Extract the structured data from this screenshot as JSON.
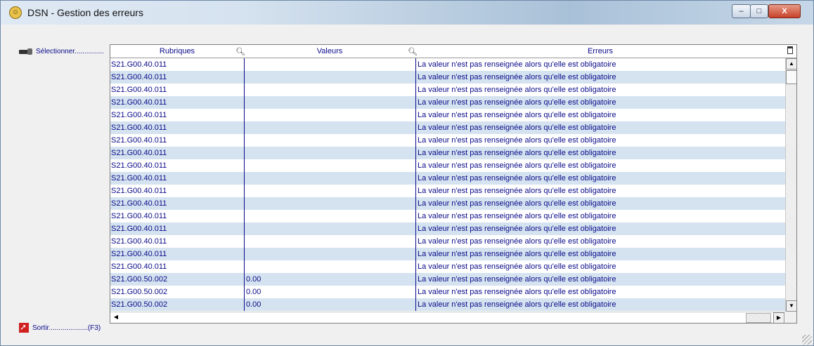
{
  "window": {
    "title": "DSN - Gestion des erreurs",
    "controls": {
      "minimize": "–",
      "maximize": "□",
      "close": "X"
    }
  },
  "sidebar": {
    "select_label": "Sélectionner...............",
    "exit_label": "Sortir....................(F3)"
  },
  "grid": {
    "columns": [
      "Rubriques",
      "Valeurs",
      "Erreurs"
    ],
    "rows": [
      {
        "rubrique": "S21.G00.40.011",
        "valeur": "",
        "erreur": "La valeur n'est pas renseignée alors qu'elle est obligatoire"
      },
      {
        "rubrique": "S21.G00.40.011",
        "valeur": "",
        "erreur": "La valeur n'est pas renseignée alors qu'elle est obligatoire"
      },
      {
        "rubrique": "S21.G00.40.011",
        "valeur": "",
        "erreur": "La valeur n'est pas renseignée alors qu'elle est obligatoire"
      },
      {
        "rubrique": "S21.G00.40.011",
        "valeur": "",
        "erreur": "La valeur n'est pas renseignée alors qu'elle est obligatoire"
      },
      {
        "rubrique": "S21.G00.40.011",
        "valeur": "",
        "erreur": "La valeur n'est pas renseignée alors qu'elle est obligatoire"
      },
      {
        "rubrique": "S21.G00.40.011",
        "valeur": "",
        "erreur": "La valeur n'est pas renseignée alors qu'elle est obligatoire"
      },
      {
        "rubrique": "S21.G00.40.011",
        "valeur": "",
        "erreur": "La valeur n'est pas renseignée alors qu'elle est obligatoire"
      },
      {
        "rubrique": "S21.G00.40.011",
        "valeur": "",
        "erreur": "La valeur n'est pas renseignée alors qu'elle est obligatoire"
      },
      {
        "rubrique": "S21.G00.40.011",
        "valeur": "",
        "erreur": "La valeur n'est pas renseignée alors qu'elle est obligatoire"
      },
      {
        "rubrique": "S21.G00.40.011",
        "valeur": "",
        "erreur": "La valeur n'est pas renseignée alors qu'elle est obligatoire"
      },
      {
        "rubrique": "S21.G00.40.011",
        "valeur": "",
        "erreur": "La valeur n'est pas renseignée alors qu'elle est obligatoire"
      },
      {
        "rubrique": "S21.G00.40.011",
        "valeur": "",
        "erreur": "La valeur n'est pas renseignée alors qu'elle est obligatoire"
      },
      {
        "rubrique": "S21.G00.40.011",
        "valeur": "",
        "erreur": "La valeur n'est pas renseignée alors qu'elle est obligatoire"
      },
      {
        "rubrique": "S21.G00.40.011",
        "valeur": "",
        "erreur": "La valeur n'est pas renseignée alors qu'elle est obligatoire"
      },
      {
        "rubrique": "S21.G00.40.011",
        "valeur": "",
        "erreur": "La valeur n'est pas renseignée alors qu'elle est obligatoire"
      },
      {
        "rubrique": "S21.G00.40.011",
        "valeur": "",
        "erreur": "La valeur n'est pas renseignée alors qu'elle est obligatoire"
      },
      {
        "rubrique": "S21.G00.40.011",
        "valeur": "",
        "erreur": "La valeur n'est pas renseignée alors qu'elle est obligatoire"
      },
      {
        "rubrique": "S21.G00.50.002",
        "valeur": "0.00",
        "erreur": "La valeur n'est pas renseignée alors qu'elle est obligatoire"
      },
      {
        "rubrique": "S21.G00.50.002",
        "valeur": "0.00",
        "erreur": "La valeur n'est pas renseignée alors qu'elle est obligatoire"
      },
      {
        "rubrique": "S21.G00.50.002",
        "valeur": "0.00",
        "erreur": "La valeur n'est pas renseignée alors qu'elle est obligatoire"
      },
      {
        "rubrique": "S21.G00.50.002",
        "valeur": "0.00",
        "erreur": "La valeur n'est pas renseignée alors qu'elle est obligatoire"
      }
    ]
  },
  "colors": {
    "row_alt": "#d4e3ef",
    "text": "#0a0a8a"
  }
}
